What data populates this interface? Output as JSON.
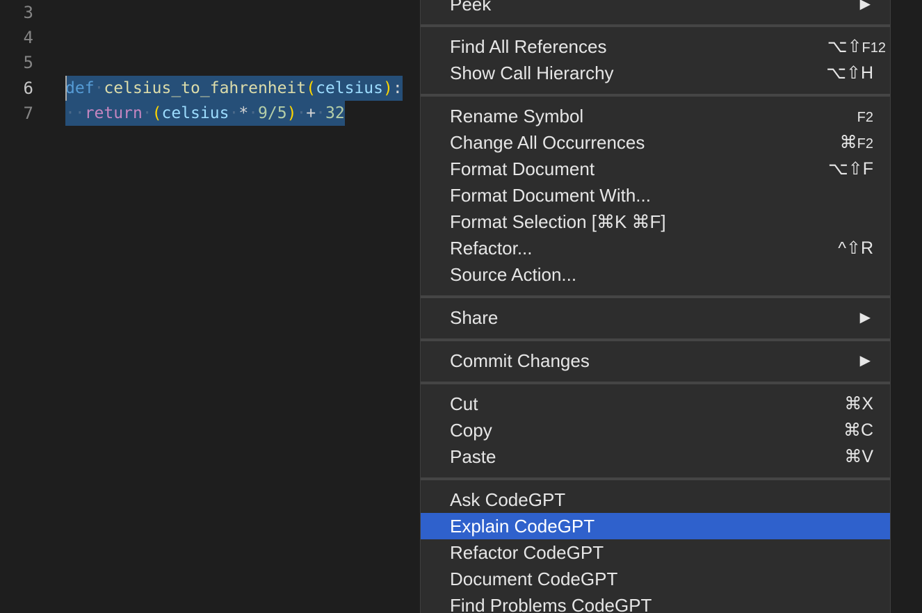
{
  "editor": {
    "line_numbers": [
      "3",
      "4",
      "5",
      "6",
      "7"
    ],
    "code": {
      "line6": {
        "kw_def": "def",
        "fn_name": "celsius_to_fahrenheit",
        "open_paren": "(",
        "param": "celsius",
        "close_paren": ")",
        "colon": ":"
      },
      "line7": {
        "indent": "··",
        "kw_return": "return",
        "open_paren": "(",
        "param": "celsius",
        "op_mul": "*",
        "expr": "9/5",
        "close_paren": ")",
        "op_add": "+",
        "num": "32"
      }
    }
  },
  "context_menu": {
    "items": [
      {
        "label": "Peek",
        "shortcut": "",
        "submenu": true
      },
      {
        "label": "Find All References",
        "shortcut": "⌥⇧",
        "shortcut_small": "F12"
      },
      {
        "label": "Show Call Hierarchy",
        "shortcut": "⌥⇧H"
      },
      {
        "label": "Rename Symbol",
        "shortcut": "",
        "shortcut_small": "F2"
      },
      {
        "label": "Change All Occurrences",
        "shortcut": "⌘",
        "shortcut_small": "F2"
      },
      {
        "label": "Format Document",
        "shortcut": "⌥⇧F"
      },
      {
        "label": "Format Document With...",
        "shortcut": ""
      },
      {
        "label": "Format Selection [⌘K ⌘F]",
        "shortcut": ""
      },
      {
        "label": "Refactor...",
        "shortcut": "^⇧R"
      },
      {
        "label": "Source Action...",
        "shortcut": ""
      },
      {
        "label": "Share",
        "submenu": true
      },
      {
        "label": "Commit Changes",
        "submenu": true
      },
      {
        "label": "Cut",
        "shortcut": "⌘X"
      },
      {
        "label": "Copy",
        "shortcut": "⌘C"
      },
      {
        "label": "Paste",
        "shortcut": "⌘V"
      },
      {
        "label": "Ask CodeGPT",
        "shortcut": ""
      },
      {
        "label": "Explain CodeGPT",
        "shortcut": "",
        "highlighted": true
      },
      {
        "label": "Refactor CodeGPT",
        "shortcut": ""
      },
      {
        "label": "Document CodeGPT",
        "shortcut": ""
      },
      {
        "label": "Find Problems CodeGPT",
        "shortcut": ""
      }
    ],
    "submenu_arrow": "▶"
  },
  "colors": {
    "editor_bg": "#1e1e1e",
    "menu_bg": "#2d2d2d",
    "highlight": "#2f61cc",
    "selection": "#264f78"
  }
}
